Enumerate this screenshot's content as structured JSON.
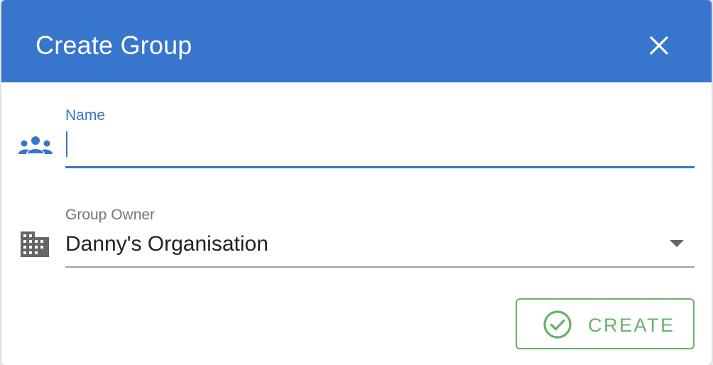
{
  "dialog": {
    "title": "Create Group",
    "close_icon": "close-icon"
  },
  "name_field": {
    "label": "Name",
    "value": "",
    "icon": "group-icon"
  },
  "owner_field": {
    "label": "Group Owner",
    "selected": "Danny's Organisation",
    "icon": "building-icon"
  },
  "actions": {
    "create_label": "CREATE",
    "create_icon": "check-circle-icon"
  },
  "colors": {
    "header": "#3875cd",
    "accent": "#3875cd",
    "create": "#6bb06a"
  }
}
